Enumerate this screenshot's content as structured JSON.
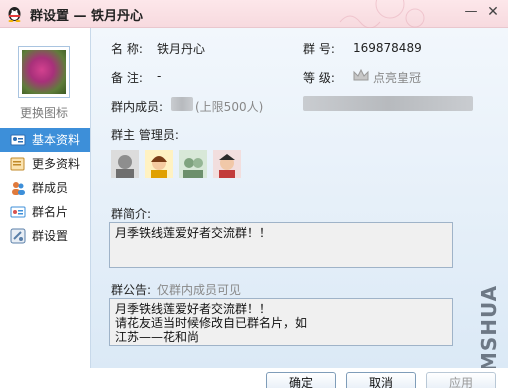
{
  "window": {
    "title": "群设置 — 铁月丹心",
    "minimize": "—",
    "close": "✕"
  },
  "left": {
    "change_avatar": "更换图标",
    "nav": [
      {
        "label": "基本资料",
        "icon": "profile-card-icon"
      },
      {
        "label": "更多资料",
        "icon": "more-info-icon"
      },
      {
        "label": "群成员",
        "icon": "members-icon"
      },
      {
        "label": "群名片",
        "icon": "card-icon"
      },
      {
        "label": "群设置",
        "icon": "settings-icon"
      }
    ]
  },
  "info": {
    "name_label": "名  称:",
    "name_value": "铁月丹心",
    "number_label": "群  号:",
    "number_value": "169878489",
    "remark_label": "备  注:",
    "remark_value": "-",
    "level_label": "等  级:",
    "level_value": "点亮皇冠",
    "members_label": "群内成员:",
    "members_limit": "(上限500人)",
    "owner_admin_label": "群主 管理员:"
  },
  "intro": {
    "label": "群简介:",
    "text": "月季铁线莲爱好者交流群！！"
  },
  "notice": {
    "label": "群公告:",
    "hint": "仅群内成员可见",
    "lines": [
      "月季铁线莲爱好者交流群！！",
      "请花友适当时候修改自已群名片，如",
      "江苏——花和尚"
    ]
  },
  "watermark": "MSHUA",
  "buttons": {
    "ok": "确定",
    "cancel": "取消",
    "apply": "应用"
  }
}
